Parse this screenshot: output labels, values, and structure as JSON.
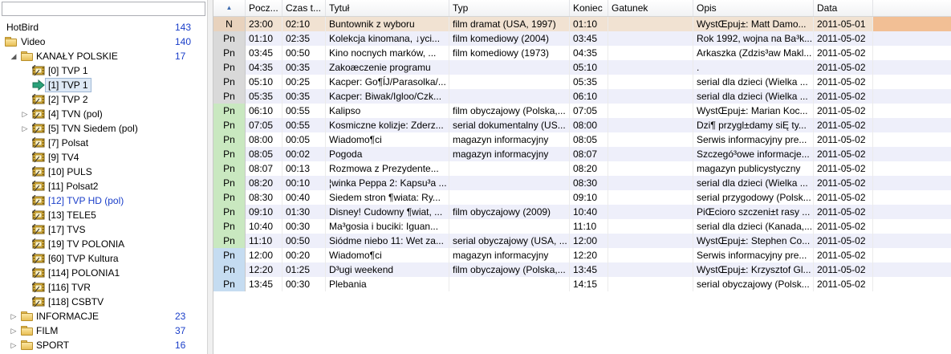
{
  "tree": {
    "search_placeholder": "",
    "items": [
      {
        "label": "HotBird",
        "count": "143",
        "level": 0,
        "icon": "none",
        "arrow": ""
      },
      {
        "label": "Video",
        "count": "140",
        "level": 1,
        "icon": "folder",
        "arrow": ""
      },
      {
        "label": "KANAŁY POLSKIE",
        "count": "17",
        "level": 2,
        "icon": "folder",
        "arrow": "◢"
      },
      {
        "label": "[0]  TVP 1",
        "count": "",
        "level": 3,
        "icon": "channel",
        "arrow": ""
      },
      {
        "label": "[1]  TVP 1",
        "count": "",
        "level": 3,
        "icon": "current",
        "arrow": "",
        "selected": true
      },
      {
        "label": "[2]  TVP 2",
        "count": "",
        "level": 3,
        "icon": "channel",
        "arrow": ""
      },
      {
        "label": "[4]  TVN (pol)",
        "count": "",
        "level": 3,
        "icon": "channel",
        "arrow": "▷"
      },
      {
        "label": "[5]  TVN Siedem (pol)",
        "count": "",
        "level": 3,
        "icon": "channel",
        "arrow": "▷"
      },
      {
        "label": "[7]  Polsat",
        "count": "",
        "level": 3,
        "icon": "channel",
        "arrow": ""
      },
      {
        "label": "[9]  TV4",
        "count": "",
        "level": 3,
        "icon": "channel",
        "arrow": ""
      },
      {
        "label": "[10]  PULS",
        "count": "",
        "level": 3,
        "icon": "channel",
        "arrow": ""
      },
      {
        "label": "[11]  Polsat2",
        "count": "",
        "level": 3,
        "icon": "channel",
        "arrow": ""
      },
      {
        "label": "[12]  TVP HD (pol)",
        "count": "",
        "level": 3,
        "icon": "channel",
        "arrow": "",
        "blue": true
      },
      {
        "label": "[13]  TELE5",
        "count": "",
        "level": 3,
        "icon": "channel",
        "arrow": ""
      },
      {
        "label": "[17]  TVS",
        "count": "",
        "level": 3,
        "icon": "channel",
        "arrow": ""
      },
      {
        "label": "[19]  TV POLONIA",
        "count": "",
        "level": 3,
        "icon": "channel",
        "arrow": ""
      },
      {
        "label": "[60]  TVP Kultura",
        "count": "",
        "level": 3,
        "icon": "channel",
        "arrow": ""
      },
      {
        "label": "[114]  POLONIA1",
        "count": "",
        "level": 3,
        "icon": "channel",
        "arrow": ""
      },
      {
        "label": "[116]  TVR",
        "count": "",
        "level": 3,
        "icon": "channel",
        "arrow": ""
      },
      {
        "label": "[118]  CSBTV",
        "count": "",
        "level": 3,
        "icon": "channel",
        "arrow": ""
      },
      {
        "label": "INFORMACJE",
        "count": "23",
        "level": 2,
        "icon": "folder",
        "arrow": "▷"
      },
      {
        "label": "FILM",
        "count": "37",
        "level": 2,
        "icon": "folder",
        "arrow": "▷"
      },
      {
        "label": "SPORT",
        "count": "16",
        "level": 2,
        "icon": "folder",
        "arrow": "▷"
      }
    ]
  },
  "grid": {
    "sort_indicator": "▲",
    "columns": [
      "Pocz...",
      "Czas t...",
      "Tytuł",
      "Typ",
      "Koniec",
      "Gatunek",
      "Opis",
      "Data"
    ],
    "rows": [
      [
        "N",
        "23:00",
        "02:10",
        "Buntownik z wyboru",
        "film dramat (USA, 1997)",
        "01:10",
        "",
        "WystŒpuj±: Matt Damo...",
        "2011-05-01"
      ],
      [
        "Pn",
        "01:10",
        "02:35",
        "Kolekcja kinomana,  ↓yci...",
        "film komediowy (2004)",
        "03:45",
        "",
        "Rok 1992, wojna na Ba³k...",
        "2011-05-02"
      ],
      [
        "Pn",
        "03:45",
        "00:50",
        "Kino nocnych marków,  ...",
        "film komediowy (1973)",
        "04:35",
        "",
        "Arkaszka (Zdzis³aw Makl...",
        "2011-05-02"
      ],
      [
        "Pn",
        "04:35",
        "00:35",
        "Zakoæczenie programu",
        "",
        "05:10",
        "",
        ".",
        "2011-05-02"
      ],
      [
        "Pn",
        "05:10",
        "00:25",
        "Kacper: Go¶ĺJ/Parasolka/...",
        "",
        "05:35",
        "",
        "serial dla dzieci (Wielka ...",
        "2011-05-02"
      ],
      [
        "Pn",
        "05:35",
        "00:35",
        "Kacper: Biwak/Igloo/Czk...",
        "",
        "06:10",
        "",
        "serial dla dzieci (Wielka ...",
        "2011-05-02"
      ],
      [
        "Pn",
        "06:10",
        "00:55",
        "Kalipso",
        "film obyczajowy (Polska,...",
        "07:05",
        "",
        "WystŒpuj±: Marian Koc...",
        "2011-05-02"
      ],
      [
        "Pn",
        "07:05",
        "00:55",
        "Kosmiczne kolizje: Zderz...",
        "serial dokumentalny (US...",
        "08:00",
        "",
        "Dzi¶ przygl±damy siĘ ty...",
        "2011-05-02"
      ],
      [
        "Pn",
        "08:00",
        "00:05",
        "Wiadomo¶ci",
        "magazyn informacyjny",
        "08:05",
        "",
        "Serwis informacyjny pre...",
        "2011-05-02"
      ],
      [
        "Pn",
        "08:05",
        "00:02",
        "Pogoda",
        "magazyn informacyjny",
        "08:07",
        "",
        "Szczegó³owe informacje...",
        "2011-05-02"
      ],
      [
        "Pn",
        "08:07",
        "00:13",
        "Rozmowa z Prezydente...",
        "",
        "08:20",
        "",
        "magazyn publicystyczny",
        "2011-05-02"
      ],
      [
        "Pn",
        "08:20",
        "00:10",
        "¦winka Peppa 2: Kapsu³a ...",
        "",
        "08:30",
        "",
        "serial dla dzieci (Wielka ...",
        "2011-05-02"
      ],
      [
        "Pn",
        "08:30",
        "00:40",
        "Siedem stron ¶wiata: Ry...",
        "",
        "09:10",
        "",
        "serial przygodowy (Polsk...",
        "2011-05-02"
      ],
      [
        "Pn",
        "09:10",
        "01:30",
        "Disney! Cudowny ¶wiat, ...",
        "film obyczajowy (2009)",
        "10:40",
        "",
        "PiŒcioro szczeni±t rasy ...",
        "2011-05-02"
      ],
      [
        "Pn",
        "10:40",
        "00:30",
        "Ma³gosia i buciki: Iguan...",
        "",
        "11:10",
        "",
        "serial dla dzieci (Kanada,...",
        "2011-05-02"
      ],
      [
        "Pn",
        "11:10",
        "00:50",
        "Siódme niebo 11: Wet za...",
        "serial obyczajowy (USA, ...",
        "12:00",
        "",
        "WystŒpuj±: Stephen Co...",
        "2011-05-02"
      ],
      [
        "Pn",
        "12:00",
        "00:20",
        "Wiadomo¶ci",
        "magazyn informacyjny",
        "12:20",
        "",
        "Serwis informacyjny pre...",
        "2011-05-02"
      ],
      [
        "Pn",
        "12:20",
        "01:25",
        "D³ugi weekend",
        "film obyczajowy (Polska,...",
        "13:45",
        "",
        "WystŒpuj±: Krzysztof Gl...",
        "2011-05-02"
      ],
      [
        "Pn",
        "13:45",
        "00:30",
        "Plebania",
        "",
        "14:15",
        "",
        "serial obyczajowy (Polsk...",
        "2011-05-02"
      ]
    ]
  },
  "colors": {
    "row_current_bg": "#f1e2d2",
    "row_current_extra": "#f2bf95",
    "row_alt_bg": "#eeeffa",
    "day_green": "#c9e8c0",
    "day_blue": "#c5dcf1",
    "day_gray": "#d9d9d9",
    "day_current": "#e8d2bd",
    "count_blue": "#1a3ec9",
    "channel_arrow": "#2aa27a"
  }
}
